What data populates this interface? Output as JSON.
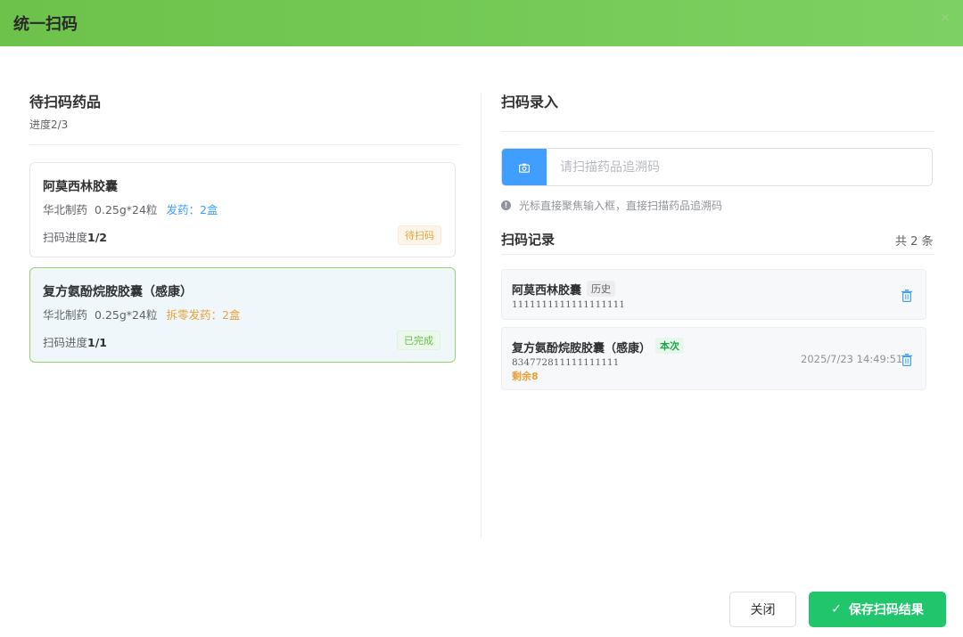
{
  "dialog": {
    "title": "统一扫码",
    "close_glyph": "×"
  },
  "left": {
    "title": "待扫码药品",
    "progress": "进度2/3",
    "cards": [
      {
        "name": "阿莫西林胶囊",
        "maker": "华北制药",
        "spec": "0.25g*24粒",
        "dispense": "发药：2盒",
        "progress_label": "扫码进度",
        "progress_value": "1/2",
        "status": "待扫码"
      },
      {
        "name": "复方氨酚烷胺胶囊（感康）",
        "maker": "华北制药",
        "spec": "0.25g*24粒",
        "dispense": "拆零发药：2盒",
        "progress_label": "扫码进度",
        "progress_value": "1/1",
        "status": "已完成"
      }
    ]
  },
  "right": {
    "title": "扫码录入",
    "scan": {
      "placeholder": "请扫描药品追溯码",
      "value": ""
    },
    "hint": "光标直接聚焦输入框，直接扫描药品追溯码",
    "records_title": "扫码记录",
    "records_count": "共 2 条",
    "records": [
      {
        "name": "阿莫西林胶囊",
        "tag": "历史",
        "code": "1111111111111111111"
      },
      {
        "name": "复方氨酚烷胺胶囊（感康）",
        "tag": "本次",
        "code": "834772811111111111",
        "remain": "剩余8",
        "time": "2025/7/23 14:49:51"
      }
    ]
  },
  "footer": {
    "close_label": "关闭",
    "save_label": "保存扫码结果"
  },
  "colors": {
    "primary_green": "#21c56b",
    "header_green": "#6cc24a",
    "accent_blue": "#409eff",
    "warning_orange": "#e6a23c"
  },
  "icons": {
    "scan": "camera-icon",
    "hint": "info-icon",
    "delete": "trash-icon",
    "save": "check-icon"
  }
}
